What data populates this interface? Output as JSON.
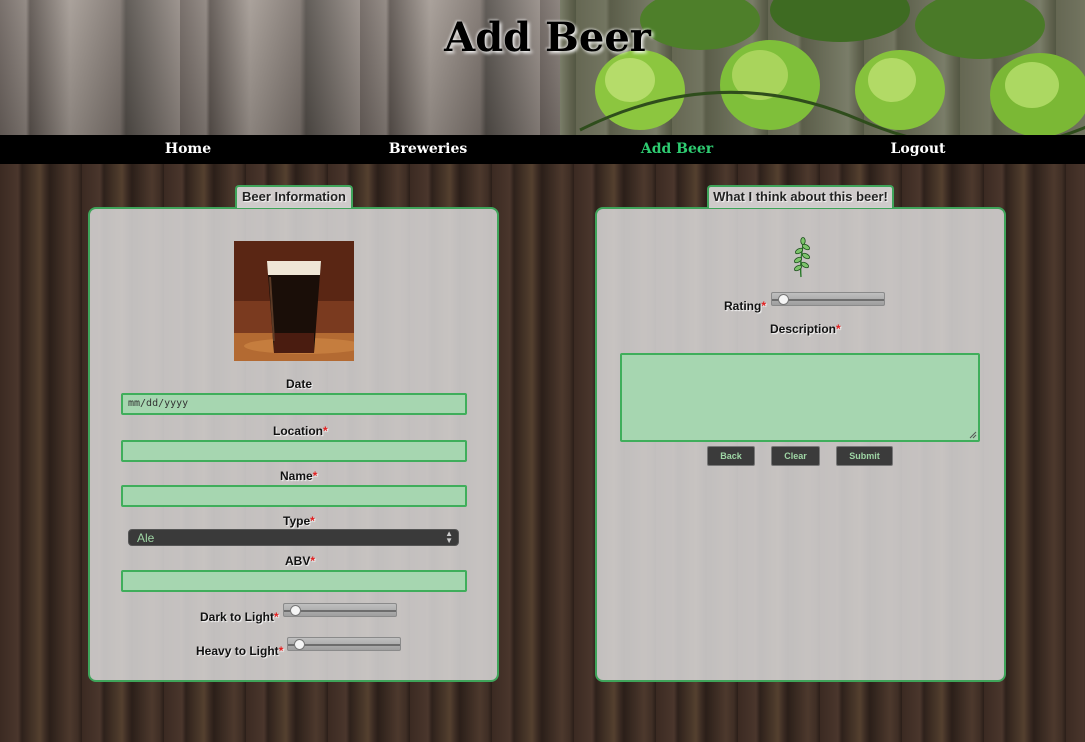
{
  "header": {
    "title": "Add Beer"
  },
  "nav": {
    "items": [
      {
        "label": "Home",
        "active": false
      },
      {
        "label": "Breweries",
        "active": false
      },
      {
        "label": "Add Beer",
        "active": true
      },
      {
        "label": "Logout",
        "active": false
      }
    ]
  },
  "beer_info": {
    "legend": "Beer Information",
    "date": {
      "label": "Date",
      "placeholder": "mm/dd/yyyy",
      "value": ""
    },
    "location": {
      "label": "Location",
      "required": "*",
      "value": ""
    },
    "name": {
      "label": "Name",
      "required": "*",
      "value": ""
    },
    "type": {
      "label": "Type",
      "required": "*",
      "selected": "Ale"
    },
    "abv": {
      "label": "ABV",
      "required": "*",
      "value": ""
    },
    "dark_to_light": {
      "label": "Dark to Light",
      "required": "*",
      "level": 0
    },
    "heavy_to_light": {
      "label": "Heavy to Light",
      "required": "*",
      "level": 0
    }
  },
  "opinion": {
    "legend": "What I think about this beer!",
    "rating": {
      "label": "Rating",
      "required": "*",
      "level": 0
    },
    "description": {
      "label": "Description",
      "required": "*",
      "value": ""
    },
    "buttons": {
      "back": "Back",
      "clear": "Clear",
      "submit": "Submit"
    }
  },
  "colors": {
    "accent_green": "#3fae5b",
    "input_fill": "#a6d6b0",
    "nav_active": "#2ecc71",
    "required": "#e02020"
  },
  "icons": [
    "beer-glass-image",
    "wheat-icon",
    "select-arrows-icon"
  ]
}
